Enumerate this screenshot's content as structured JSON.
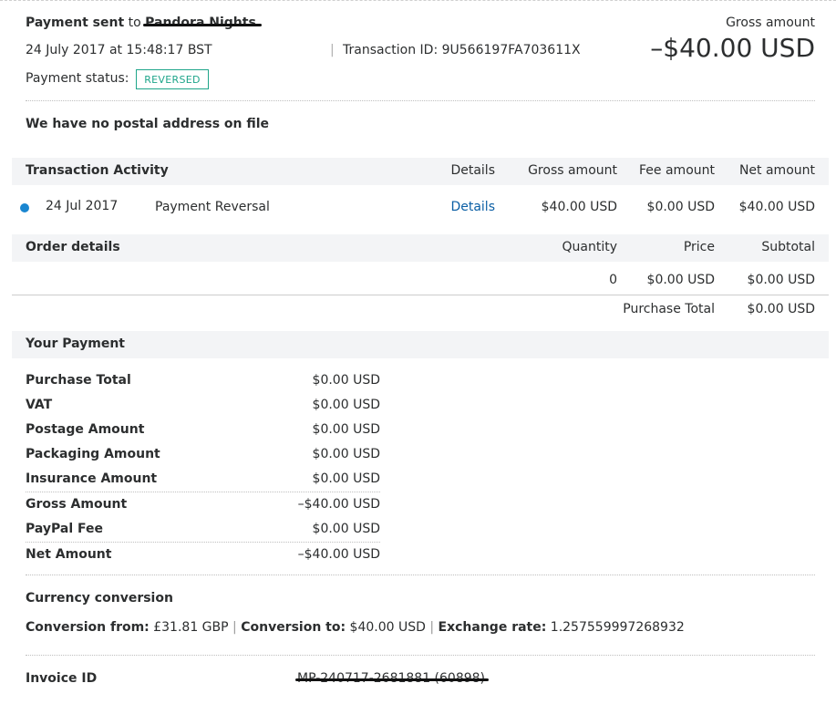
{
  "header": {
    "payment_sent_label": "Payment sent",
    "to_label": "to",
    "recipient": "Pandora Nights",
    "datetime": "24 July 2017 at 15:48:17 BST",
    "transaction_id_label": "Transaction ID:",
    "transaction_id": "9U566197FA703611X",
    "status_label": "Payment status:",
    "status": "REVERSED",
    "gross_amount_label": "Gross amount",
    "gross_amount": "–$40.00 USD"
  },
  "postal_note": "We have no postal address on file",
  "transaction_activity": {
    "title": "Transaction Activity",
    "columns": [
      "Details",
      "Gross amount",
      "Fee amount",
      "Net amount"
    ],
    "row": {
      "date": "24 Jul 2017",
      "type": "Payment Reversal",
      "details_link": "Details",
      "gross": "$40.00 USD",
      "fee": "$0.00 USD",
      "net": "$40.00 USD"
    }
  },
  "order_details": {
    "title": "Order details",
    "columns": [
      "Quantity",
      "Price",
      "Subtotal"
    ],
    "row": {
      "quantity": "0",
      "price": "$0.00 USD",
      "subtotal": "$0.00 USD"
    },
    "purchase_total_label": "Purchase Total",
    "purchase_total": "$0.00 USD"
  },
  "your_payment": {
    "title": "Your Payment",
    "rows": [
      {
        "label": "Purchase Total",
        "value": "$0.00 USD"
      },
      {
        "label": "VAT",
        "value": "$0.00 USD"
      },
      {
        "label": "Postage Amount",
        "value": "$0.00 USD"
      },
      {
        "label": "Packaging Amount",
        "value": "$0.00 USD"
      },
      {
        "label": "Insurance Amount",
        "value": "$0.00 USD"
      },
      {
        "label": "Gross Amount",
        "value": "–$40.00 USD"
      },
      {
        "label": "PayPal Fee",
        "value": "$0.00 USD"
      },
      {
        "label": "Net Amount",
        "value": "–$40.00 USD"
      }
    ]
  },
  "currency_conversion": {
    "title": "Currency conversion",
    "from_label": "Conversion from:",
    "from_value": "£31.81 GBP",
    "to_label": "Conversion to:",
    "to_value": "$40.00 USD",
    "rate_label": "Exchange rate:",
    "rate_value": "1.257559997268932",
    "separator": "|"
  },
  "invoice": {
    "label": "Invoice ID",
    "value": "MP-240717-2681881 (60898)"
  },
  "colors": {
    "status_badge": "#1ea58a",
    "link": "#0b5fa5",
    "dot": "#1a86d0",
    "band": "#f3f4f6"
  }
}
